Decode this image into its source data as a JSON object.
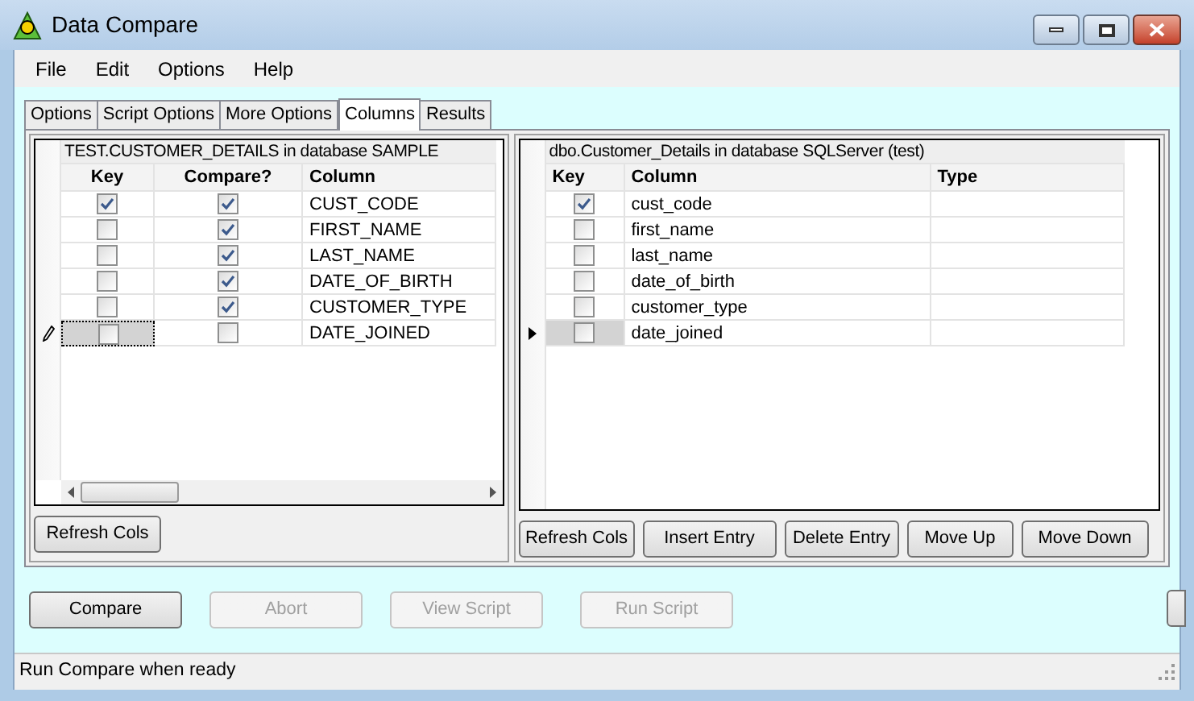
{
  "window": {
    "title": "Data Compare"
  },
  "menu": [
    "File",
    "Edit",
    "Options",
    "Help"
  ],
  "tabs": [
    {
      "label": "Options",
      "selected": false
    },
    {
      "label": "Script Options",
      "selected": false
    },
    {
      "label": "More Options",
      "selected": false
    },
    {
      "label": "Columns",
      "selected": true
    },
    {
      "label": "Results",
      "selected": false
    }
  ],
  "source_grid": {
    "title": "TEST.CUSTOMER_DETAILS in database SAMPLE",
    "columns": [
      "Key",
      "Compare?",
      "Column"
    ],
    "rows": [
      {
        "key": true,
        "compare": true,
        "column": "CUST_CODE",
        "selected": false,
        "editing": false
      },
      {
        "key": false,
        "compare": true,
        "column": "FIRST_NAME",
        "selected": false,
        "editing": false
      },
      {
        "key": false,
        "compare": true,
        "column": "LAST_NAME",
        "selected": false,
        "editing": false
      },
      {
        "key": false,
        "compare": true,
        "column": "DATE_OF_BIRTH",
        "selected": false,
        "editing": false
      },
      {
        "key": false,
        "compare": true,
        "column": "CUSTOMER_TYPE",
        "selected": false,
        "editing": false
      },
      {
        "key": false,
        "compare": false,
        "column": "DATE_JOINED",
        "selected": true,
        "editing": true
      }
    ],
    "buttons": [
      "Refresh Cols"
    ]
  },
  "target_grid": {
    "title": "dbo.Customer_Details in database SQLServer (test)",
    "columns": [
      "Key",
      "Column",
      "Type"
    ],
    "rows": [
      {
        "key": true,
        "column": "cust_code",
        "selected": false,
        "editing": false
      },
      {
        "key": false,
        "column": "first_name",
        "selected": false,
        "editing": false
      },
      {
        "key": false,
        "column": "last_name",
        "selected": false,
        "editing": false
      },
      {
        "key": false,
        "column": "date_of_birth",
        "selected": false,
        "editing": false
      },
      {
        "key": false,
        "column": "customer_type",
        "selected": false,
        "editing": false
      },
      {
        "key": false,
        "column": "date_joined",
        "selected": true,
        "editing": false
      }
    ],
    "buttons": [
      "Refresh Cols",
      "Insert Entry",
      "Delete Entry",
      "Move Up",
      "Move Down"
    ]
  },
  "actions": [
    {
      "label": "Compare",
      "disabled": false
    },
    {
      "label": "Abort",
      "disabled": true
    },
    {
      "label": "View Script",
      "disabled": true
    },
    {
      "label": "Run Script",
      "disabled": true
    }
  ],
  "status_bar": "Run Compare when ready"
}
